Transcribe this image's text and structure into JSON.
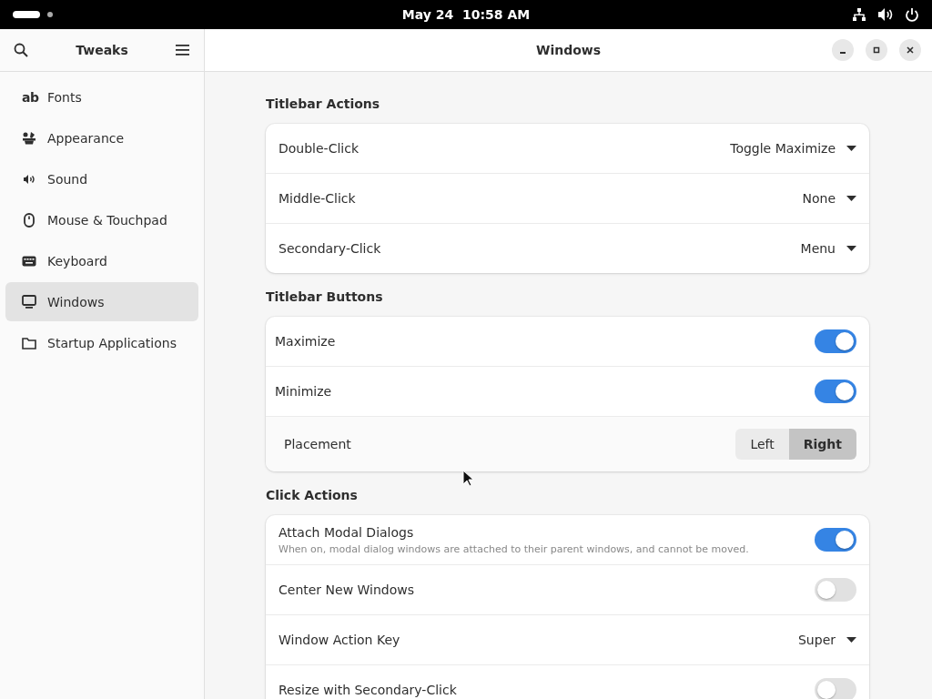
{
  "top_bar": {
    "clock": "May 24  10:58 AM"
  },
  "sidebar": {
    "title": "Tweaks",
    "items": [
      {
        "label": "Fonts",
        "kind": "fonts",
        "glyph": "ab",
        "selected": false
      },
      {
        "label": "Appearance",
        "kind": "appearance",
        "selected": false
      },
      {
        "label": "Sound",
        "kind": "sound",
        "selected": false
      },
      {
        "label": "Mouse & Touchpad",
        "kind": "mouse",
        "selected": false
      },
      {
        "label": "Keyboard",
        "kind": "keyboard",
        "selected": false
      },
      {
        "label": "Windows",
        "kind": "windows",
        "selected": true
      },
      {
        "label": "Startup Applications",
        "kind": "folder",
        "selected": false
      }
    ]
  },
  "main": {
    "title": "Windows",
    "sections": [
      {
        "title": "Titlebar Actions",
        "rows": [
          {
            "kind": "dropdown",
            "label": "Double-Click",
            "value": "Toggle Maximize"
          },
          {
            "kind": "dropdown",
            "label": "Middle-Click",
            "value": "None"
          },
          {
            "kind": "dropdown",
            "label": "Secondary-Click",
            "value": "Menu"
          }
        ]
      },
      {
        "title": "Titlebar Buttons",
        "rows": [
          {
            "kind": "switch",
            "label": "Maximize",
            "on": true
          },
          {
            "kind": "switch",
            "label": "Minimize",
            "on": true
          },
          {
            "kind": "segmented",
            "label": "Placement",
            "options": [
              {
                "label": "Left",
                "selected": false
              },
              {
                "label": "Right",
                "selected": true
              }
            ]
          }
        ]
      },
      {
        "title": "Click Actions",
        "rows": [
          {
            "kind": "switch",
            "label": "Attach Modal Dialogs",
            "subtitle": "When on, modal dialog windows are attached to their parent windows, and cannot be moved.",
            "on": true
          },
          {
            "kind": "switch",
            "label": "Center New Windows",
            "on": false
          },
          {
            "kind": "dropdown",
            "label": "Window Action Key",
            "value": "Super"
          },
          {
            "kind": "switch",
            "label": "Resize with Secondary-Click",
            "on": false
          }
        ]
      }
    ]
  }
}
